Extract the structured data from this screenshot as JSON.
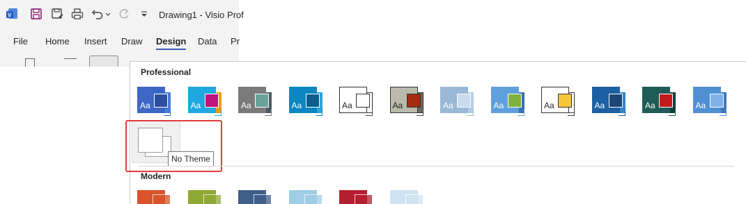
{
  "window": {
    "title": "Drawing1 - Visio Prof"
  },
  "quick_access": {
    "icons": [
      "visio-logo-icon",
      "save-icon",
      "save-as-icon",
      "print-icon",
      "undo-icon",
      "undo-dropdown-icon",
      "redo-icon",
      "customize-dropdown-icon"
    ]
  },
  "ribbon": {
    "tabs": [
      {
        "label": "File"
      },
      {
        "label": "Home"
      },
      {
        "label": "Insert"
      },
      {
        "label": "Draw"
      },
      {
        "label": "Design",
        "active": true
      },
      {
        "label": "Data"
      },
      {
        "label": "Pr"
      }
    ]
  },
  "gallery": {
    "professional_header": "Professional",
    "modern_header": "Modern",
    "aa_label": "Aa",
    "no_theme_tooltip": "No Theme",
    "professional_themes": [
      {
        "big": "#3d67c4",
        "mid": "#2f4f9c",
        "small": "#4b7bd6",
        "text": true
      },
      {
        "big": "#1fa7e0",
        "mid": "#c2137a",
        "small": "#f29a1e",
        "text": true
      },
      {
        "big": "#7a7a7a",
        "mid": "#6aa29a",
        "small": "#4c5a66",
        "text": true
      },
      {
        "big": "#0b86c0",
        "mid": "#0c5f8d",
        "small": "#2ea3d9",
        "text": true
      },
      {
        "big": "#ffffff",
        "mid": "#ffffff",
        "small": "#ffffff",
        "text": true,
        "dark": true
      },
      {
        "big": "#b9baa9",
        "mid": "#a32d12",
        "small": "#6b6b5c",
        "text": true,
        "dark": true
      },
      {
        "big": "#9ab7d6",
        "mid": "#c9dcef",
        "small": "#b4cce6",
        "text": true
      },
      {
        "big": "#5fa0dc",
        "mid": "#7db33b",
        "small": "#3b6fb3",
        "text": true
      },
      {
        "big": "#ffffff",
        "mid": "#f7c63b",
        "small": "#ffffff",
        "text": true,
        "dark": true
      },
      {
        "big": "#1d5fa3",
        "mid": "#1a4776",
        "small": "#3584c9",
        "text": true
      },
      {
        "big": "#1f5c57",
        "mid": "#c41c1c",
        "small": "#14403c",
        "text": true
      },
      {
        "big": "#4f8fd4",
        "mid": "#7fb1e8",
        "small": "#3f77b8",
        "text": true
      }
    ],
    "modern_themes": [
      {
        "color": "#d9532b"
      },
      {
        "color": "#8fa832"
      },
      {
        "color": "#3f5f8a"
      },
      {
        "color": "#9fcde6"
      },
      {
        "color": "#b51f2f"
      },
      {
        "color": "#cfe3f2"
      }
    ]
  }
}
